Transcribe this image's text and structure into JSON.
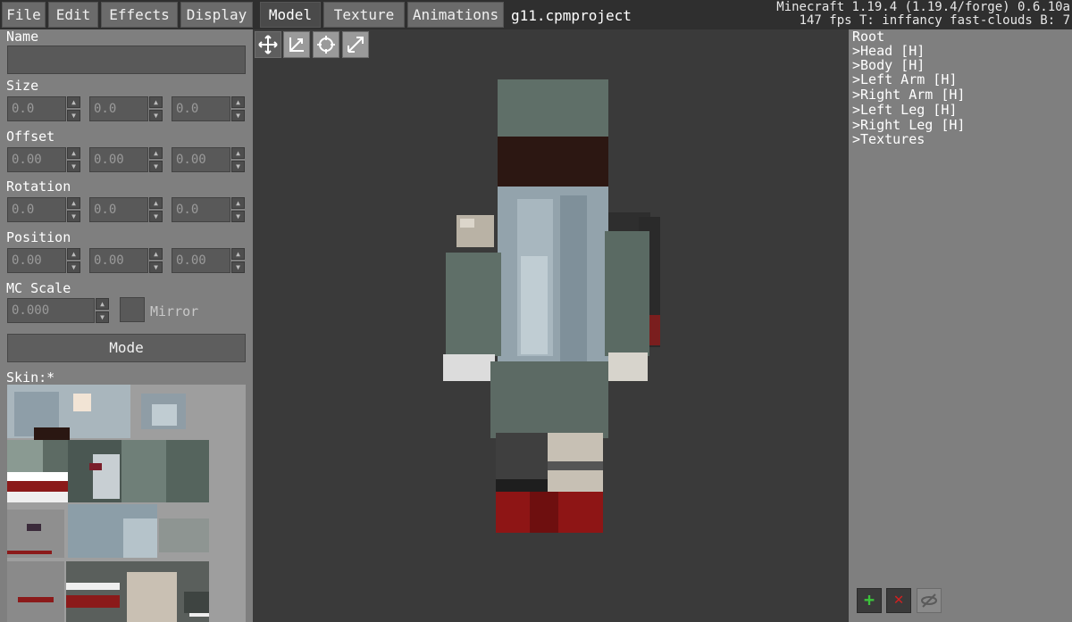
{
  "menu": {
    "items": [
      {
        "label": "File"
      },
      {
        "label": "Edit"
      },
      {
        "label": "Effects"
      },
      {
        "label": "Display"
      }
    ]
  },
  "tabs": {
    "items": [
      {
        "label": "Model"
      },
      {
        "label": "Texture"
      },
      {
        "label": "Animations"
      }
    ],
    "active": "Model"
  },
  "project": {
    "title": "g11.cpmproject"
  },
  "status": {
    "line1": "Minecraft 1.19.4 (1.19.4/forge) 0.6.10a",
    "line2": "147 fps T: inffancy fast-clouds B: 7"
  },
  "properties": {
    "name_label": "Name",
    "name_value": "",
    "size": {
      "label": "Size",
      "x": "0.0",
      "y": "0.0",
      "z": "0.0"
    },
    "offset": {
      "label": "Offset",
      "x": "0.00",
      "y": "0.00",
      "z": "0.00"
    },
    "rotation": {
      "label": "Rotation",
      "x": "0.0",
      "y": "0.0",
      "z": "0.0"
    },
    "position": {
      "label": "Position",
      "x": "0.00",
      "y": "0.00",
      "z": "0.00"
    },
    "mc_scale": {
      "label": "MC Scale",
      "value": "0.000"
    },
    "mirror_label": "Mirror",
    "mode_label": "Mode",
    "skin_label": "Skin:*"
  },
  "tree": {
    "root": "Root",
    "items": [
      {
        "label": "Head [H]"
      },
      {
        "label": "Body [H]"
      },
      {
        "label": "Left Arm [H]"
      },
      {
        "label": "Right Arm [H]"
      },
      {
        "label": "Left Leg [H]"
      },
      {
        "label": "Right Leg [H]"
      },
      {
        "label": "Textures"
      }
    ],
    "expander": ">"
  },
  "actions": {
    "add": "+",
    "delete": "✕"
  },
  "icons": {
    "move": "move-arrows-icon",
    "scale": "scale-icon",
    "rotate": "rotate-icon",
    "resize": "resize-diagonal-icon"
  },
  "colors": {
    "add_green": "#3cc23c",
    "delete_red": "#d32020",
    "panel_grey": "#7f7f7f",
    "viewport_dark": "#3a3a3a"
  }
}
